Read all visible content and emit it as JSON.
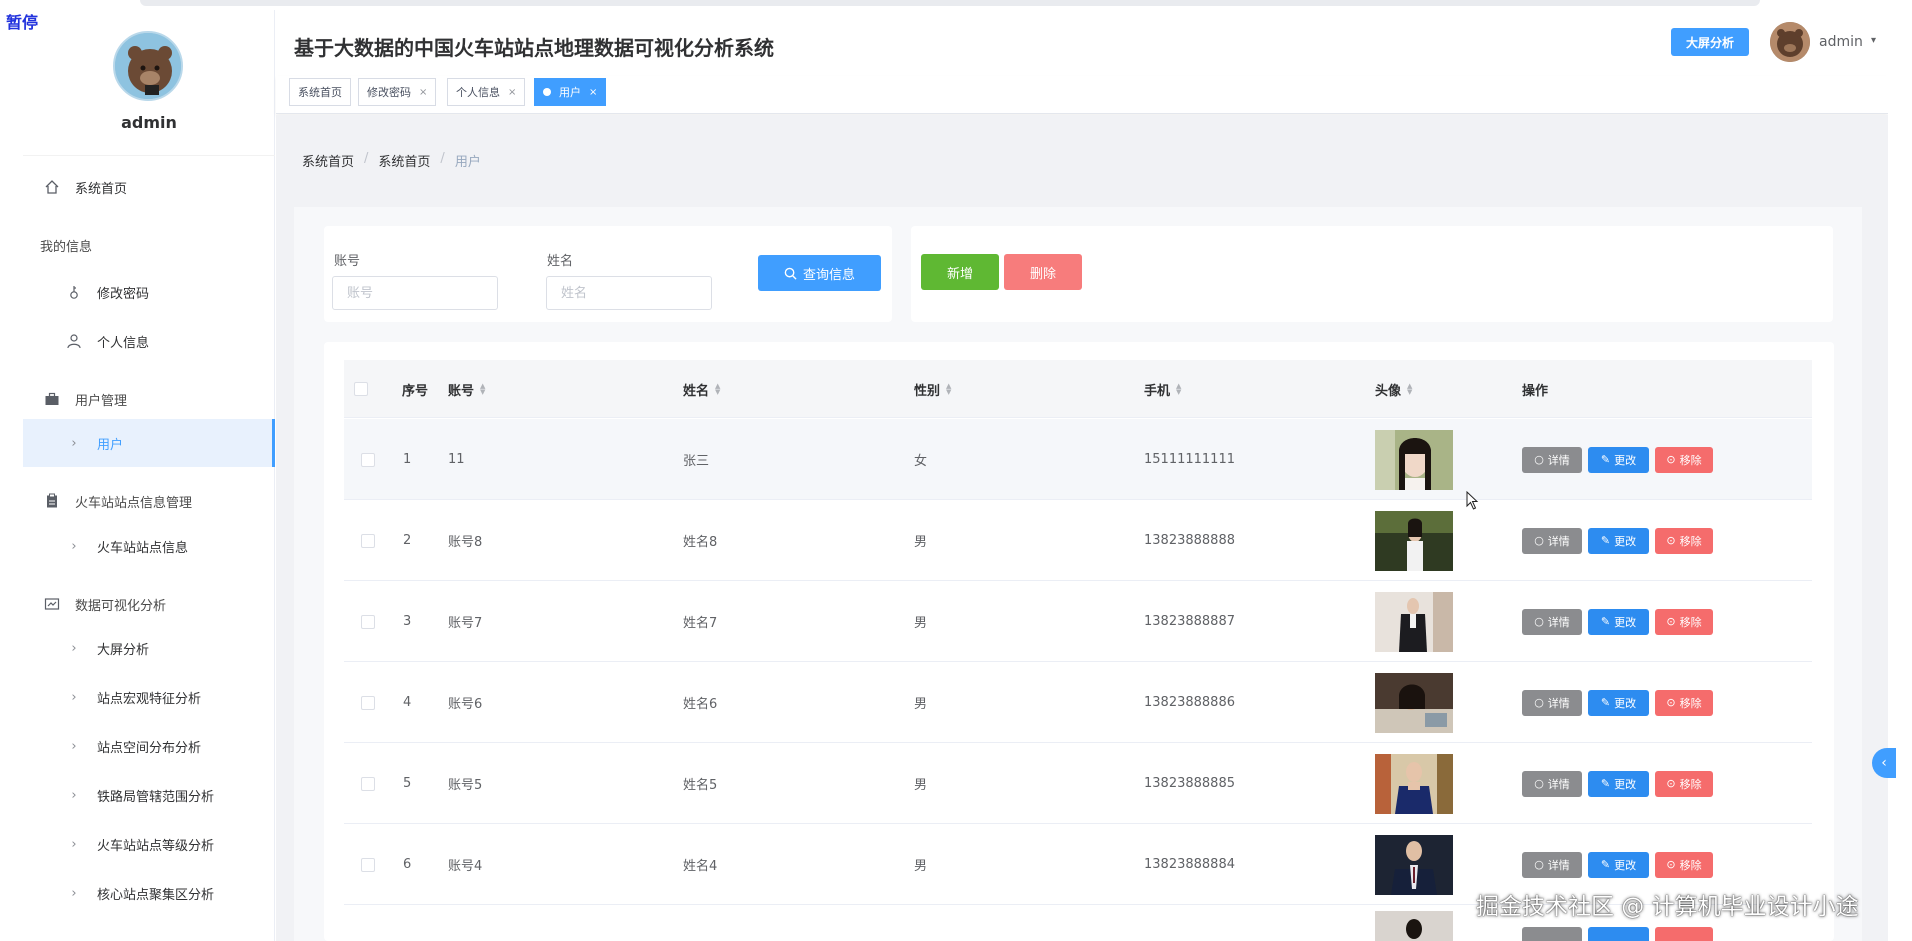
{
  "overlay": {
    "pause_label": "暂停",
    "watermark": "掘金技术社区 @ 计算机毕业设计小途"
  },
  "sidebar": {
    "username": "admin",
    "home": "系统首页",
    "my_info": {
      "title": "我的信息",
      "items": [
        "修改密码",
        "个人信息"
      ]
    },
    "user_mgmt": {
      "title": "用户管理",
      "items": [
        "用户"
      ]
    },
    "station_mgmt": {
      "title": "火车站站点信息管理",
      "items": [
        "火车站站点信息"
      ]
    },
    "viz": {
      "title": "数据可视化分析",
      "items": [
        "大屏分析",
        "站点宏观特征分析",
        "站点空间分布分析",
        "铁路局管辖范围分析",
        "火车站站点等级分析",
        "核心站点聚集区分析"
      ]
    }
  },
  "header": {
    "title": "基于大数据的中国火车站站点地理数据可视化分析系统",
    "screen_button": "大屏分析",
    "username": "admin",
    "caret": "▾"
  },
  "tabs": [
    {
      "label": "系统首页",
      "closable": false
    },
    {
      "label": "修改密码",
      "closable": true
    },
    {
      "label": "个人信息",
      "closable": true
    },
    {
      "label": "用户",
      "closable": true,
      "active": true
    }
  ],
  "tab_close": "×",
  "breadcrumb": [
    "系统首页",
    "系统首页",
    "用户"
  ],
  "breadcrumb_sep": "/",
  "search": {
    "account_label": "账号",
    "account_placeholder": "账号",
    "name_label": "姓名",
    "name_placeholder": "姓名",
    "query_button": "查询信息"
  },
  "actions": {
    "add": "新增",
    "delete": "删除"
  },
  "table": {
    "headers": {
      "index": "序号",
      "account": "账号",
      "name": "姓名",
      "gender": "性别",
      "phone": "手机",
      "avatar": "头像",
      "ops": "操作"
    },
    "sort_up": "▲",
    "sort_down": "▼",
    "rows": [
      {
        "index": "1",
        "account": "11",
        "name": "张三",
        "gender": "女",
        "phone": "15111111111"
      },
      {
        "index": "2",
        "account": "账号8",
        "name": "姓名8",
        "gender": "男",
        "phone": "13823888888"
      },
      {
        "index": "3",
        "account": "账号7",
        "name": "姓名7",
        "gender": "男",
        "phone": "13823888887"
      },
      {
        "index": "4",
        "account": "账号6",
        "name": "姓名6",
        "gender": "男",
        "phone": "13823888886"
      },
      {
        "index": "5",
        "account": "账号5",
        "name": "姓名5",
        "gender": "男",
        "phone": "13823888885"
      },
      {
        "index": "6",
        "account": "账号4",
        "name": "姓名4",
        "gender": "男",
        "phone": "13823888884"
      }
    ],
    "op_labels": {
      "detail": "详情",
      "edit": "更改",
      "remove": "移除"
    }
  },
  "colors": {
    "primary": "#409eff",
    "success": "#5fb833",
    "danger": "#f77c7c",
    "info": "#8b8c8f"
  }
}
